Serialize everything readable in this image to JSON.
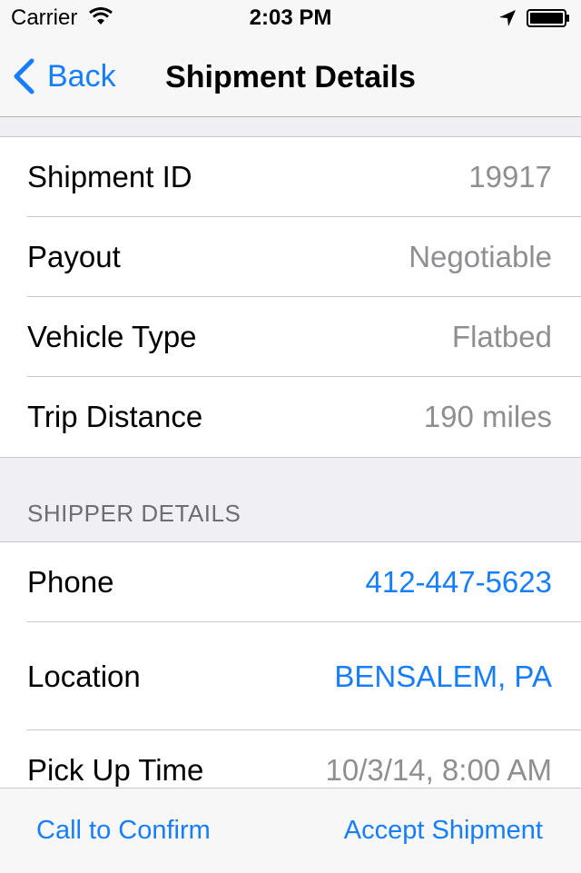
{
  "status_bar": {
    "carrier": "Carrier",
    "time": "2:03 PM"
  },
  "nav": {
    "back_label": "Back",
    "title": "Shipment Details"
  },
  "details": [
    {
      "label": "Shipment ID",
      "value": "19917"
    },
    {
      "label": "Payout",
      "value": "Negotiable"
    },
    {
      "label": "Vehicle Type",
      "value": "Flatbed"
    },
    {
      "label": "Trip Distance",
      "value": "190 miles"
    }
  ],
  "shipper": {
    "header": "SHIPPER DETAILS",
    "rows": [
      {
        "label": "Phone",
        "value": "412-447-5623"
      },
      {
        "label": "Location",
        "value": "BENSALEM, PA"
      },
      {
        "label": "Pick Up Time",
        "value": "10/3/14, 8:00 AM"
      }
    ]
  },
  "toolbar": {
    "left_label": "Call to Confirm",
    "right_label": "Accept Shipment"
  },
  "colors": {
    "accent": "#157efb",
    "secondary_text": "#8e8e93",
    "background": "#efeff4"
  }
}
